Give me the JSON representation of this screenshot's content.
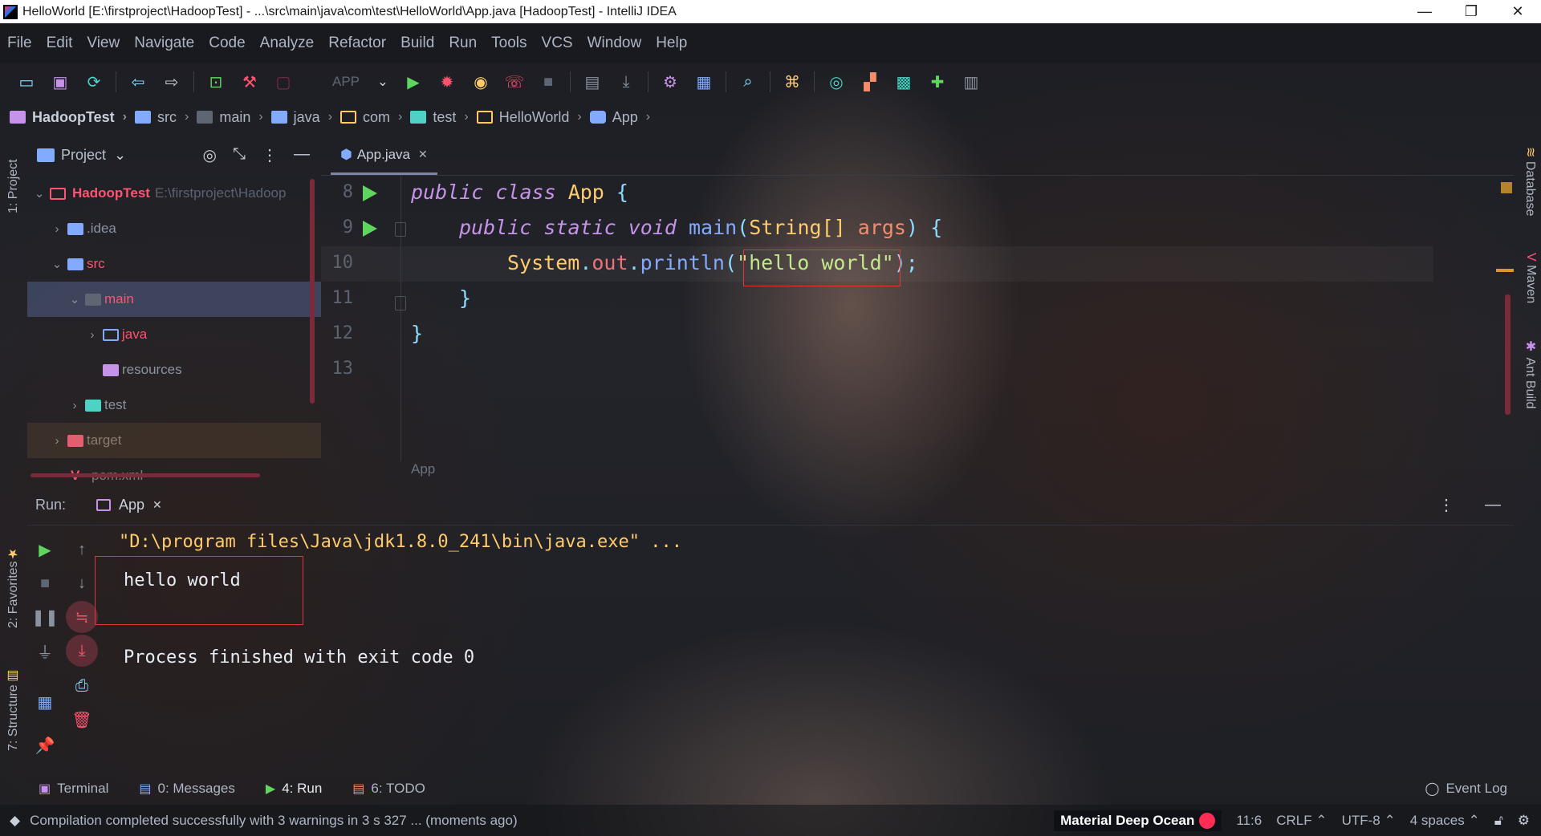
{
  "window": {
    "title": "HelloWorld [E:\\firstproject\\HadoopTest] - ...\\src\\main\\java\\com\\test\\HelloWorld\\App.java [HadoopTest] - IntelliJ IDEA",
    "minimize": "—",
    "restore": "❐",
    "close": "✕"
  },
  "menu": [
    "File",
    "Edit",
    "View",
    "Navigate",
    "Code",
    "Analyze",
    "Refactor",
    "Build",
    "Run",
    "Tools",
    "VCS",
    "Window",
    "Help"
  ],
  "toolbar": {
    "run_config": "APP"
  },
  "breadcrumb": [
    "HadoopTest",
    "src",
    "main",
    "java",
    "com",
    "test",
    "HelloWorld",
    "App"
  ],
  "side_tabs": {
    "project": "1: Project",
    "favorites": "2: Favorites",
    "structure": "7: Structure",
    "database": "Database",
    "maven": "Maven",
    "ant": "Ant Build"
  },
  "project": {
    "header": "Project",
    "root": {
      "name": "HadoopTest",
      "path": "E:\\firstproject\\Hadoop"
    },
    "items": [
      ".idea",
      "src",
      "main",
      "java",
      "resources",
      "test",
      "target",
      "pom.xml"
    ]
  },
  "editor": {
    "tab": "App.java",
    "line_numbers": [
      "8",
      "9",
      "10",
      "11",
      "12",
      "13"
    ],
    "code": {
      "l8_kw": "public class",
      "l8_cls": "App",
      "l8_brace": "{",
      "l9_kw": "public static void",
      "l9_fn": "main",
      "l9_open": "(",
      "l9_type": "String[]",
      "l9_param": "args",
      "l9_close": ") {",
      "l10_cls": "System",
      "l10_dot1": ".",
      "l10_field": "out",
      "l10_dot2": ".",
      "l10_fn": "println",
      "l10_open": "(",
      "l10_str": "\"hello world\"",
      "l10_close": ");",
      "l11": "}",
      "l12": "}"
    },
    "crumb": "App"
  },
  "run": {
    "label": "Run:",
    "tab": "App",
    "console": [
      "\"D:\\program files\\Java\\jdk1.8.0_241\\bin\\java.exe\" ...",
      "hello world",
      "Process finished with exit code 0"
    ]
  },
  "bottom_tabs": {
    "terminal": "Terminal",
    "messages": "0: Messages",
    "run": "4: Run",
    "todo": "6: TODO",
    "event_log": "Event Log"
  },
  "status": {
    "message": "Compilation completed successfully with 3 warnings in 3 s 327 ... (moments ago)",
    "theme": "Material Deep Ocean",
    "position": "11:6",
    "line_sep": "CRLF ⌃",
    "encoding": "UTF-8 ⌃",
    "indent": "4 spaces ⌃"
  },
  "colors": {
    "run_green": "#5fd45f",
    "debug_red": "#ff5370",
    "accent": "#ff2d55",
    "highlight_box": "#e0353d"
  }
}
